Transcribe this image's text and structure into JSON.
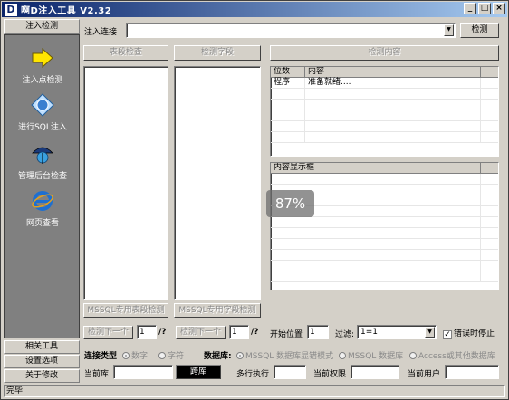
{
  "window": {
    "title": "啊D注入工具 V2.32",
    "icon_letter": "D",
    "btn_min": "_",
    "btn_max": "□",
    "btn_close": "×"
  },
  "sidebar": {
    "header": "注入检测",
    "items": [
      {
        "label": "注入点检测",
        "icon": "arrow-icon"
      },
      {
        "label": "进行SQL注入",
        "icon": "diamond-icon"
      },
      {
        "label": "管理后台检查",
        "icon": "globe-umbrella-icon"
      },
      {
        "label": "网页查看",
        "icon": "ie-icon"
      }
    ],
    "footer": [
      "相关工具",
      "设置选项",
      "关于修改"
    ]
  },
  "inject": {
    "label": "注入连接",
    "value": "",
    "check_button": "检测"
  },
  "tabs": {
    "table_check": "表段检查",
    "field_check": "检测字段",
    "detect_content": "检测内容"
  },
  "log_table": {
    "headers": [
      "位数",
      "内容"
    ],
    "rows": [
      {
        "pos": "程序",
        "content": "准备就绪...."
      }
    ]
  },
  "display_box": {
    "header": "内容显示框"
  },
  "mssql_buttons": {
    "table": "MSSQL专用表段检测",
    "field": "MSSQL专用字段检测"
  },
  "paging": {
    "next1": "检测下一个",
    "page1": "1",
    "suffix1": "/?",
    "next2": "检测下一个",
    "page2": "1",
    "suffix2": "/?",
    "start_label": "开始位置",
    "start_value": "1",
    "filter_label": "过滤:",
    "filter_value": "1=1",
    "stop_on_error": "错误时停止"
  },
  "conn": {
    "type_label": "连接类型",
    "numeric": "数字",
    "char": "字符",
    "db_label": "数据库:",
    "mssql_show": "MSSQL 数据库显错模式",
    "mssql_db": "MSSQL 数据库",
    "access": "Access或其他数据库"
  },
  "current": {
    "db_label": "当前库",
    "db_value": "",
    "cross_button": "跨库",
    "multi_label": "多行执行",
    "multi_value": "",
    "perm_label": "当前权限",
    "perm_value": "",
    "user_label": "当前用户",
    "user_value": ""
  },
  "status": {
    "text": "完毕"
  },
  "overlay": {
    "text": "87%"
  }
}
